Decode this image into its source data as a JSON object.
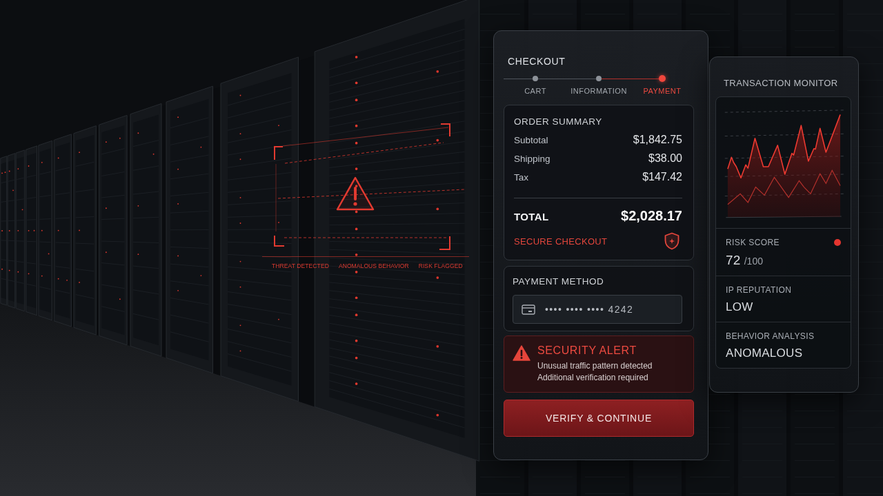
{
  "threat_overlay": {
    "tags": [
      "THREAT DETECTED",
      "ANOMALOUS BEHAVIOR",
      "RISK FLAGGED"
    ]
  },
  "checkout": {
    "title": "CHECKOUT",
    "steps": [
      {
        "label": "CART",
        "selected": false
      },
      {
        "label": "INFORMATION",
        "selected": false
      },
      {
        "label": "PAYMENT",
        "selected": true
      }
    ],
    "order_summary": {
      "title": "ORDER SUMMARY",
      "lines": [
        {
          "label": "Subtotal",
          "amount": "$1,842.75"
        },
        {
          "label": "Shipping",
          "amount": "$38.00"
        },
        {
          "label": "Tax",
          "amount": "$147.42"
        }
      ],
      "total": {
        "label": "TOTAL",
        "amount": "$2,028.17"
      },
      "secure_note": "SECURE CHECKOUT"
    },
    "payment_method": {
      "title": "PAYMENT METHOD",
      "card_number": "•••• •••• •••• 4242"
    },
    "alert": {
      "title": "SECURITY ALERT",
      "lines": [
        "Unusual traffic pattern detected",
        "Additional verification required"
      ]
    },
    "button": "VERIFY & CONTINUE"
  },
  "transaction_monitor": {
    "title": "TRANSACTION MONITOR",
    "metrics": [
      {
        "kind": "score",
        "label": "RISK SCORE",
        "value": "72",
        "max": "/100"
      },
      {
        "kind": "text",
        "label": "IP REPUTATION",
        "value": "LOW"
      },
      {
        "kind": "text",
        "label": "BEHAVIOR ANALYSIS",
        "value": "ANOMALOUS"
      }
    ]
  }
}
